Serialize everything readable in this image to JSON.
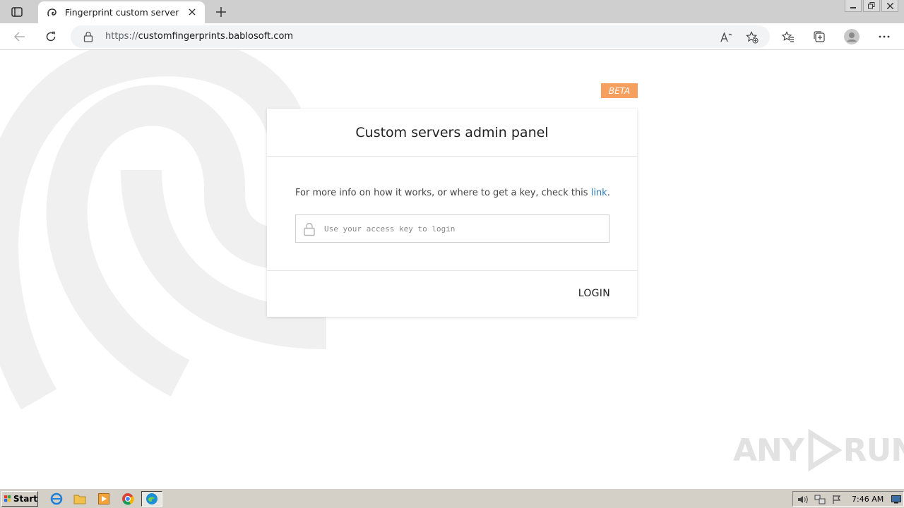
{
  "browser": {
    "tab_title": "Fingerprint custom server",
    "url_scheme": "https://",
    "url_host": "customfingerprints.bablosoft.com"
  },
  "page": {
    "beta_label": "BETA",
    "card_title": "Custom servers admin panel",
    "info_text": "For more info on how it works, or where to get a key, check this ",
    "info_link": "link",
    "info_suffix": ".",
    "key_placeholder": "Use your access key to login",
    "login_label": "LOGIN"
  },
  "watermark": {
    "left": "ANY",
    "right": "RUN"
  },
  "taskbar": {
    "start_label": "Start",
    "clock": "7:46 AM"
  },
  "colors": {
    "beta": "#f5a05f",
    "link": "#2a7ab8",
    "background_logo": "#f0f0f0"
  }
}
